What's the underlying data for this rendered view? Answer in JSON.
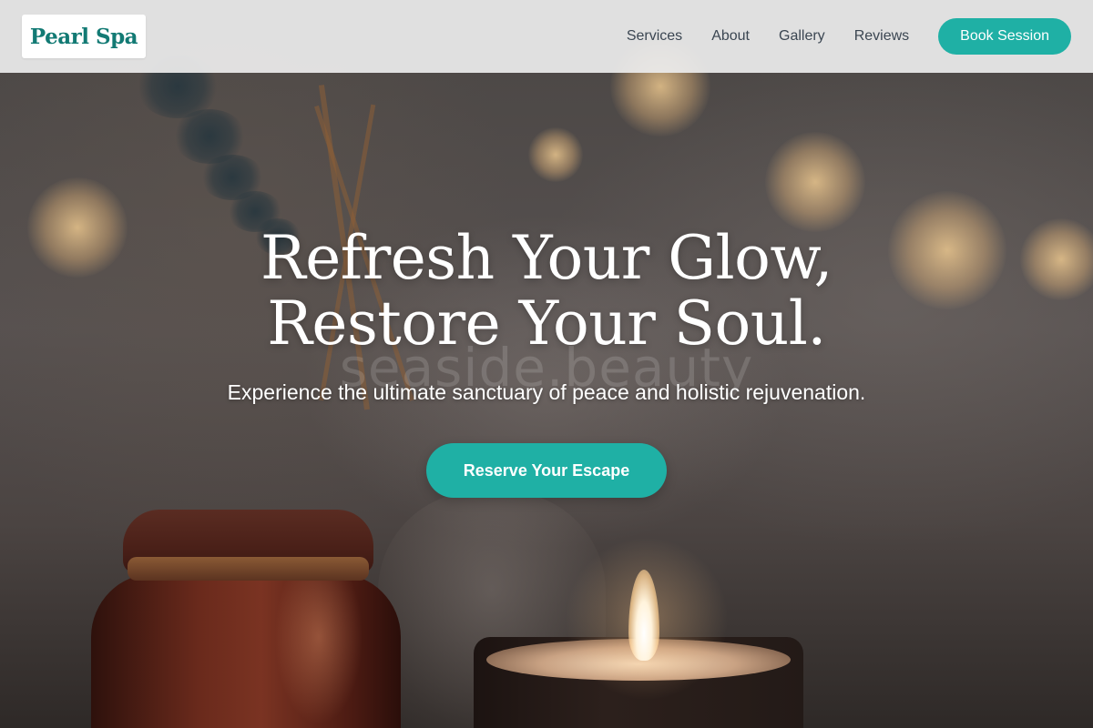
{
  "brand": {
    "name": "Pearl Spa",
    "accent_color": "#1fb0a5",
    "logo_text_color": "#127a74"
  },
  "nav": {
    "items": [
      {
        "label": "Services"
      },
      {
        "label": "About"
      },
      {
        "label": "Gallery"
      },
      {
        "label": "Reviews"
      }
    ],
    "book_label": "Book Session"
  },
  "hero": {
    "title_line1": "Refresh Your Glow,",
    "title_line2": "Restore Your Soul.",
    "watermark": "seaside.beauty",
    "subtitle": "Experience the ultimate sanctuary of peace and holistic rejuvenation.",
    "cta_label": "Reserve Your Escape"
  }
}
